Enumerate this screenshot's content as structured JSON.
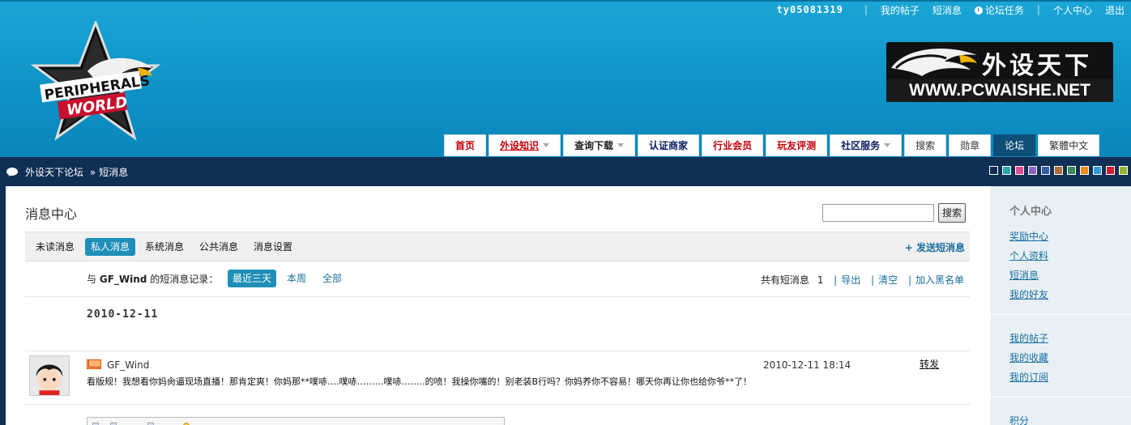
{
  "topbar": {
    "username": "ty05081319",
    "links": [
      "我的帖子",
      "短消息",
      "论坛任务",
      "个人中心",
      "退出"
    ]
  },
  "logo_right": {
    "cn": "外设天下",
    "url": "WWW.PCWAISHE.NET"
  },
  "nav": [
    {
      "label": "首页",
      "style": "red"
    },
    {
      "label": "外设知识",
      "style": "red",
      "caret": true,
      "underline": true
    },
    {
      "label": "查询下载",
      "style": "dark",
      "caret": true
    },
    {
      "label": "认证商家",
      "style": "navy"
    },
    {
      "label": "行业会员",
      "style": "red"
    },
    {
      "label": "玩友评测",
      "style": "red"
    },
    {
      "label": "社区服务",
      "style": "navy",
      "caret": true
    },
    {
      "label": "搜索",
      "style": "plain"
    },
    {
      "label": "勋章",
      "style": "plain"
    },
    {
      "label": "论坛",
      "style": "active"
    },
    {
      "label": "繁體中文",
      "style": "plain"
    }
  ],
  "breadcrumb": {
    "home": "外设天下论坛",
    "arrow": "»",
    "current": "短消息"
  },
  "swatches": [
    "#ffffff",
    "#2aa7a7",
    "#e24a8a",
    "#8a63c7",
    "#3a5ba8",
    "#a86f3a",
    "#3a8a5a",
    "#e88a20",
    "#2f9ad8",
    "#d01f2f",
    "#9ab030"
  ],
  "main": {
    "title": "消息中心",
    "search_button": "搜索",
    "tabs": [
      "未读消息",
      "私人消息",
      "系统消息",
      "公共消息",
      "消息设置"
    ],
    "active_tab": 1,
    "send_label": "+ 发送短消息",
    "record": {
      "prefix": "与",
      "user": "GF_Wind",
      "suffix": "的短消息记录：",
      "filters": [
        "最近三天",
        "本周",
        "全部"
      ],
      "total_label": "共有短消息",
      "total": "1",
      "export": "导出",
      "clear": "清空",
      "blacklist": "加入黑名单"
    },
    "date": "2010-12-11",
    "message": {
      "sender": "GF_Wind",
      "time": "2010-12-11 18:14",
      "forward": "转发",
      "body": "看版规！我想看你妈肏逼现场直播！那肯定爽！你妈那**噗哧….噗哧………噗哧……..的喷！我操你嘴的！别老装B行吗？你妈养你不容易！哪天你再让你也给你爷**了！"
    }
  },
  "sidebar": {
    "heading": "个人中心",
    "group1": [
      "奖励中心",
      "个人资料",
      "短消息",
      "我的好友"
    ],
    "group2": [
      "我的帖子",
      "我的收藏",
      "我的订阅"
    ],
    "group3": [
      "积分"
    ]
  }
}
